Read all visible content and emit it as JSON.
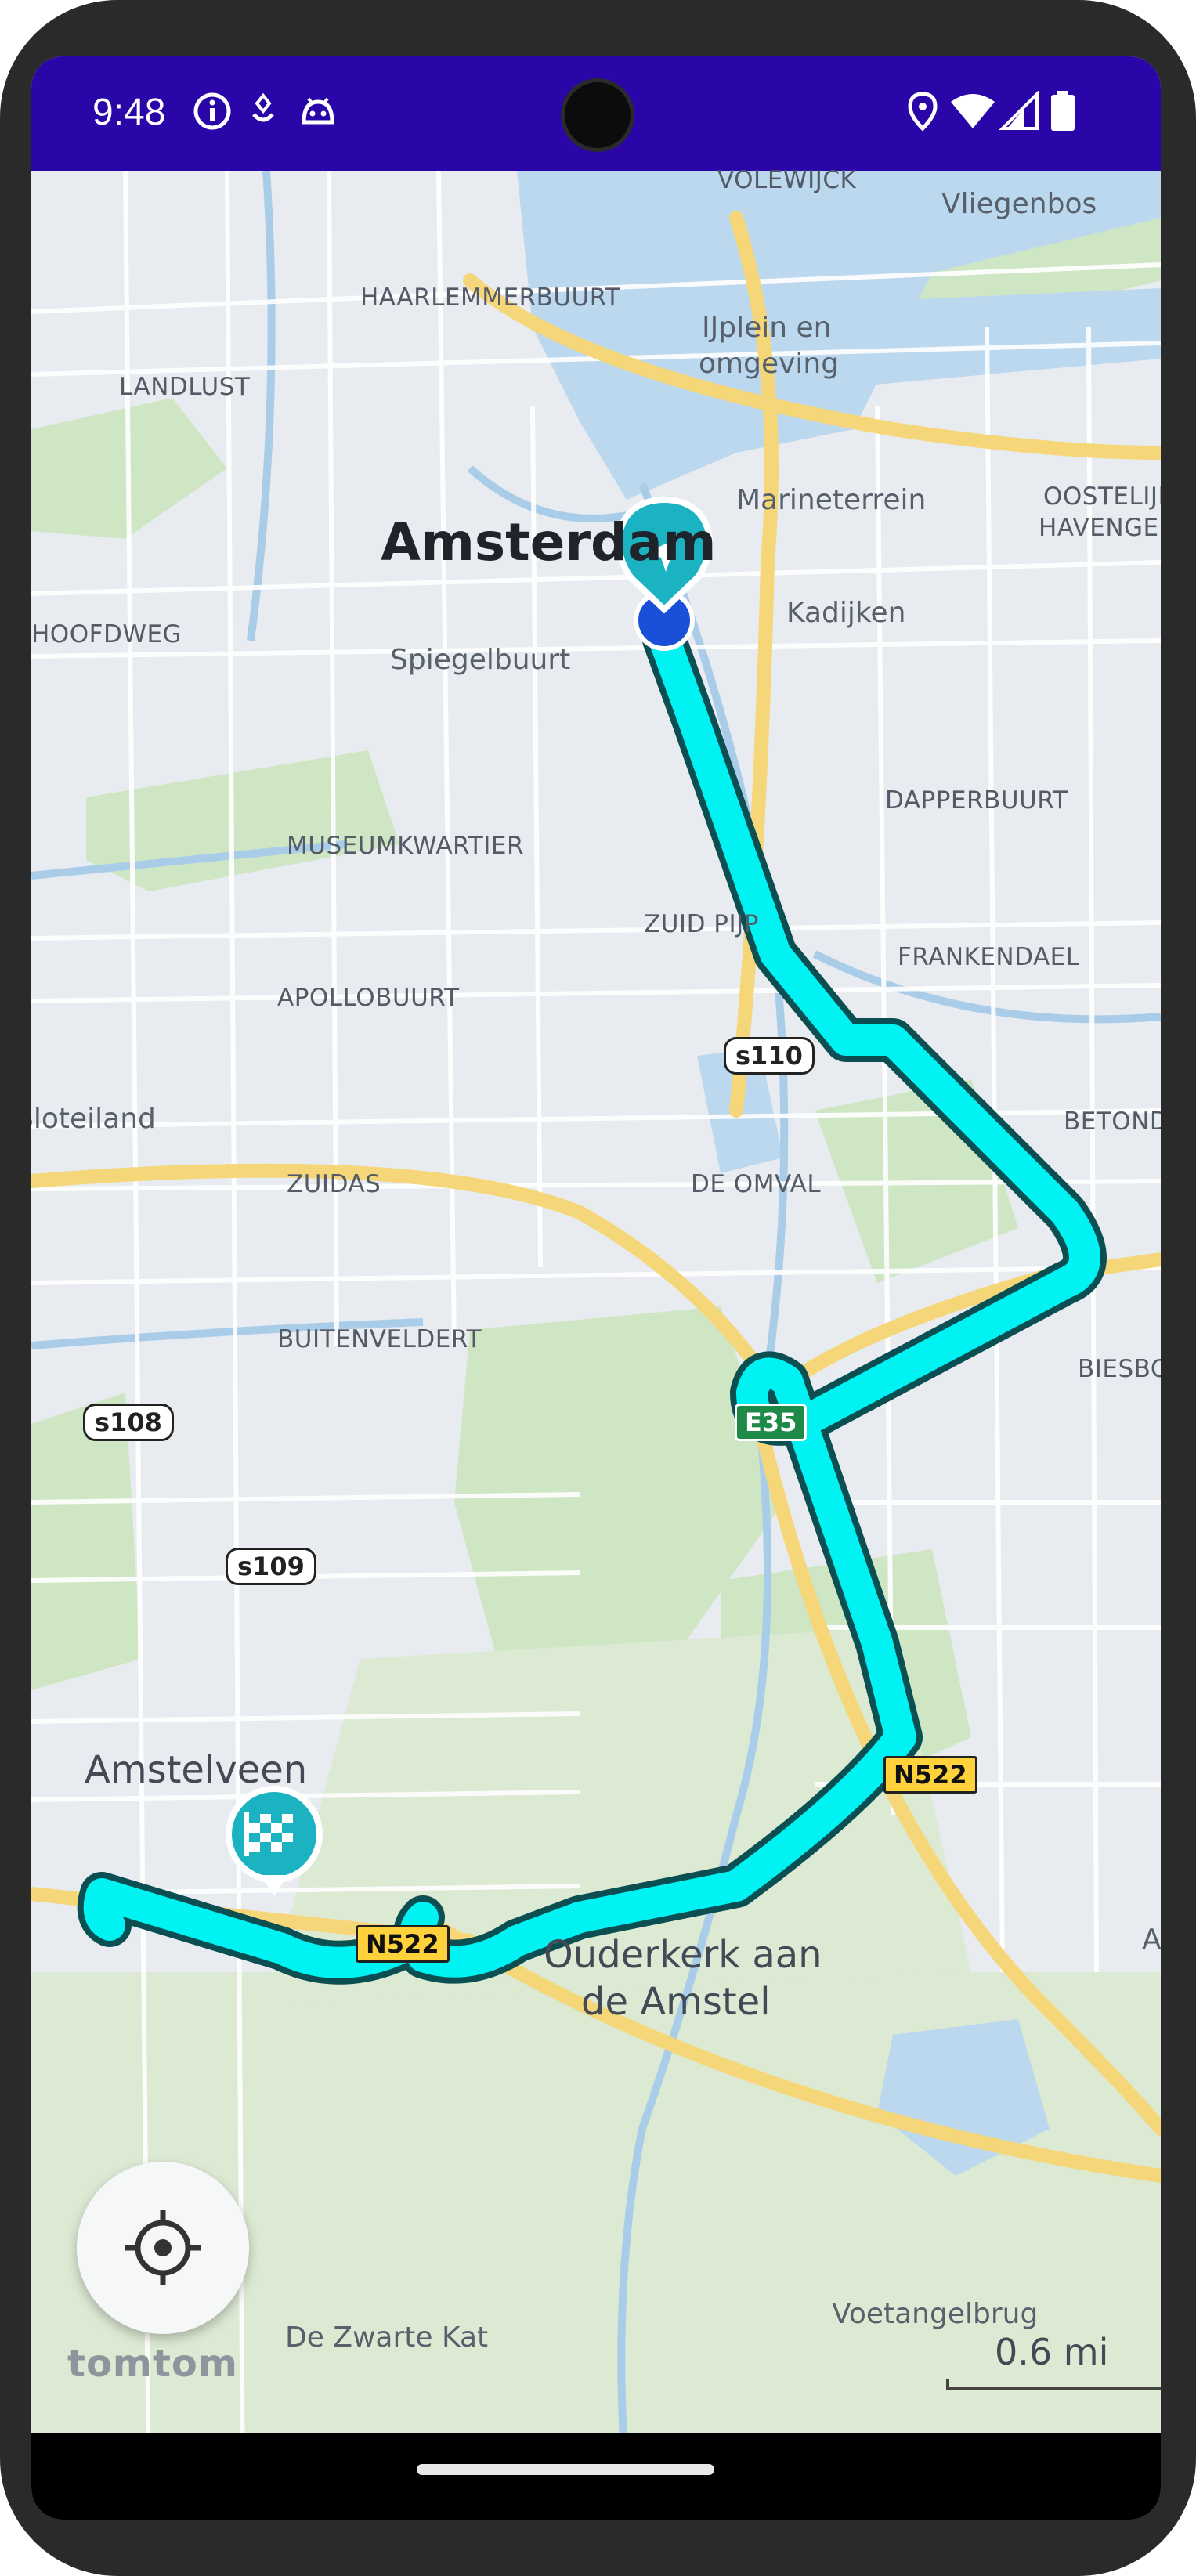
{
  "status_bar": {
    "time": "9:48",
    "left_icons": [
      "info-icon",
      "badge-icon",
      "android-icon"
    ],
    "right_icons": [
      "location-icon",
      "wifi-icon",
      "signal-icon",
      "battery-icon"
    ],
    "background_color": "#2a06a9"
  },
  "map": {
    "labels": {
      "city": "Amsterdam",
      "volewijck": "VOLEWIJCK",
      "vliegenbos": "Vliegenbos",
      "haarlemmerbuurt": "HAARLEMMERBUURT",
      "ijplein_1": "IJplein en",
      "ijplein_2": "omgeving",
      "landlust": "LANDLUST",
      "marineterrein": "Marineterrein",
      "oostelijk_1": "OOSTELIJK",
      "oostelijk_2": "HAVENGEBIED",
      "hoofdweg": "HOOFDWEG",
      "spiegelbuurt": "Spiegelbuurt",
      "kadijken": "Kadijken",
      "dapperbuurt": "DAPPERBUURT",
      "museumkwartier": "MUSEUMKWARTIER",
      "zuid_pijp": "ZUID PIJP",
      "frankendael": "FRANKENDAEL",
      "apollobuurt": "APOLLOBUURT",
      "saleiland": "Sloteiland",
      "betondorp": "BETONDORP",
      "zuidas": "ZUIDAS",
      "de_omval": "DE OMVAL",
      "buitenveldert": "BUITENVELDERT",
      "biesbosch": "BIESBOSCH",
      "amstelveen": "Amstelveen",
      "ouderkerk_1": "Ouderkerk aan",
      "ouderkerk_2": "de Amstel",
      "a_label": "A",
      "voetangelbrug": "Voetangelbrug",
      "de_zwarte_kat": "De Zwarte Kat"
    },
    "road_shields": {
      "s110": "s110",
      "s108": "s108",
      "s109": "s109",
      "e35": "E35",
      "n522_a": "N522",
      "n522_b": "N522"
    },
    "route_color": "#00f2f2",
    "route_outline_color": "#0b4f53",
    "current_location_icon": "navigation-arrow-icon",
    "destination_icon": "checkered-flag-icon"
  },
  "controls": {
    "locate_icon": "crosshair-icon",
    "logo": "tomtom",
    "scale": "0.6 mi"
  }
}
